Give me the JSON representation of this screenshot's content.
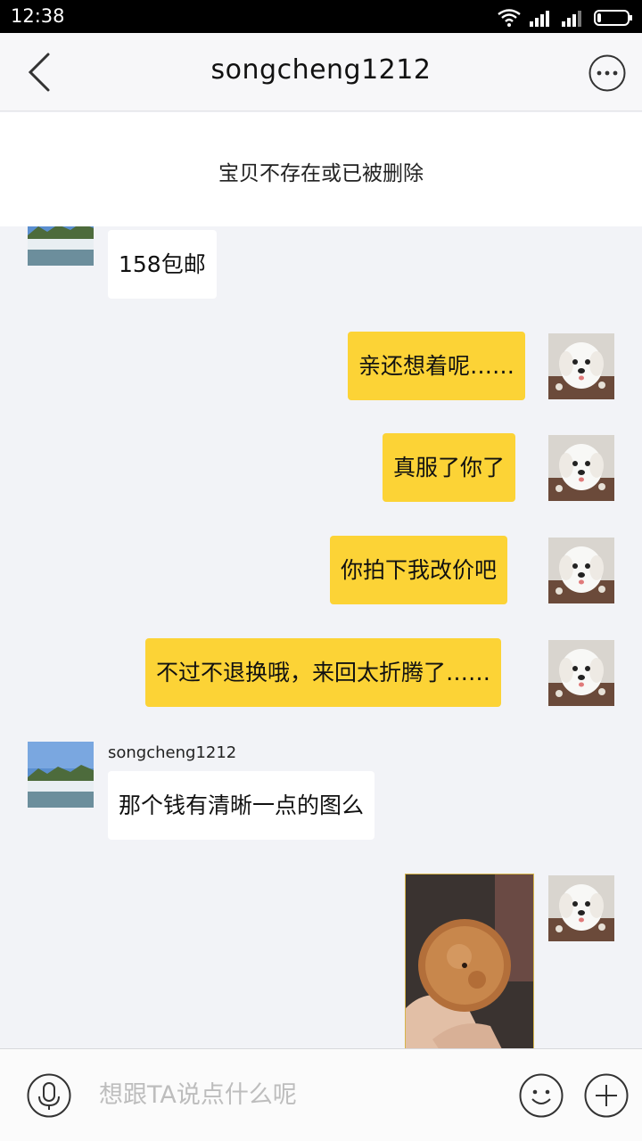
{
  "status": {
    "time": "12:38"
  },
  "header": {
    "title": "songcheng1212"
  },
  "notice": "宝贝不存在或已被删除",
  "messages": {
    "m1": "158包邮",
    "m2": "亲还想着呢……",
    "m3": "真服了你了",
    "m4": "你拍下我改价吧",
    "m5": "不过不退换哦，来回太折腾了……",
    "m6_sender": "songcheng1212",
    "m6": "那个钱有清晰一点的图么"
  },
  "input": {
    "placeholder": "想跟TA说点什么呢"
  },
  "colors": {
    "outgoing": "#fcd336",
    "incoming": "#ffffff",
    "background": "#f2f3f7"
  },
  "icons": [
    "back-icon",
    "more-icon",
    "mic-icon",
    "emoji-icon",
    "plus-icon",
    "wifi-icon",
    "signal-icon",
    "battery-icon"
  ]
}
